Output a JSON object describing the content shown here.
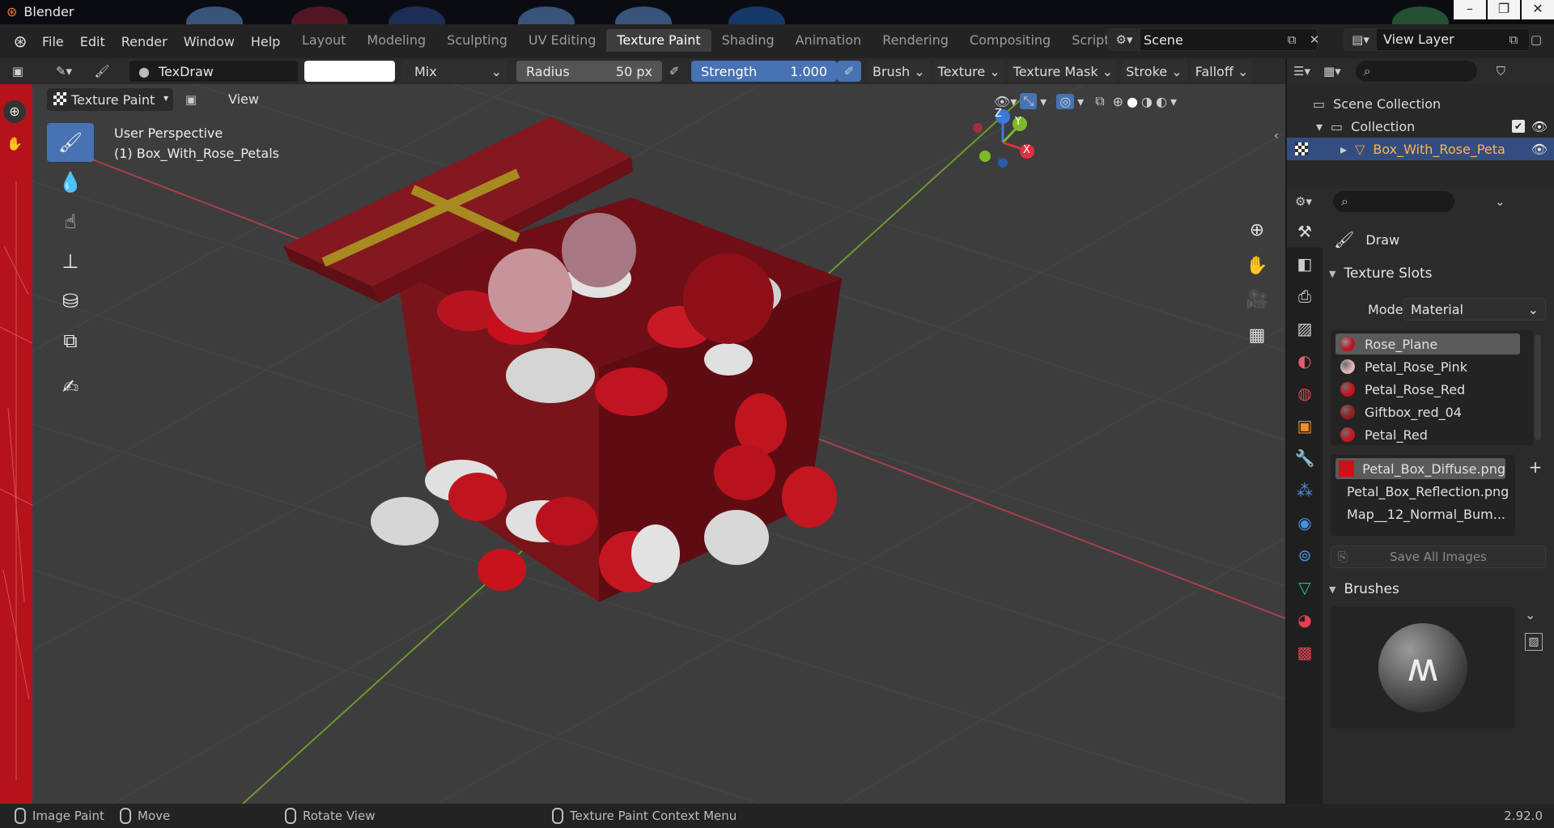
{
  "window": {
    "app_title": "Blender"
  },
  "menu": [
    "File",
    "Edit",
    "Render",
    "Window",
    "Help"
  ],
  "workspaces": [
    "Layout",
    "Modeling",
    "Sculpting",
    "UV Editing",
    "Texture Paint",
    "Shading",
    "Animation",
    "Rendering",
    "Compositing",
    "Scripting"
  ],
  "active_workspace": "Texture Paint",
  "scene": {
    "name": "Scene"
  },
  "view_layer": {
    "name": "View Layer"
  },
  "tool_header": {
    "brush_name": "TexDraw",
    "blend_mode": "Mix",
    "radius_label": "Radius",
    "radius_value": "50 px",
    "strength_label": "Strength",
    "strength_value": "1.000",
    "menus": [
      "Brush",
      "Texture",
      "Texture Mask",
      "Stroke",
      "Falloff"
    ]
  },
  "viewport_header": {
    "mode": "Texture Paint",
    "view": "View"
  },
  "viewport": {
    "perspective": "User Perspective",
    "object": "(1) Box_With_Rose_Petals",
    "gizmo_axes": {
      "z": "Z",
      "y": "Y",
      "x": "X"
    }
  },
  "outliner": {
    "scene_collection": "Scene Collection",
    "collection": "Collection",
    "object": "Box_With_Rose_Peta"
  },
  "properties": {
    "tool_name": "Draw",
    "texture_slots_title": "Texture Slots",
    "mode_label": "Mode",
    "mode_value": "Material",
    "materials": [
      {
        "name": "Rose_Plane",
        "color": "#c01420"
      },
      {
        "name": "Petal_Rose_Pink",
        "color": "#e0b0b8"
      },
      {
        "name": "Petal_Rose_Red",
        "color": "#c8101c"
      },
      {
        "name": "Giftbox_red_04",
        "color": "#9a1a20"
      },
      {
        "name": "Petal_Red",
        "color": "#c8141c"
      }
    ],
    "images": [
      {
        "name": "Petal_Box_Diffuse.png",
        "color": "#d01018"
      },
      {
        "name": "Petal_Box_Reflection.png",
        "color": "#000000"
      },
      {
        "name": "Map__12_Normal_Bum...",
        "color": "#8a80ff"
      }
    ],
    "save_all_images": "Save All Images",
    "brushes_title": "Brushes"
  },
  "status_bar": {
    "image_paint": "Image Paint",
    "move": "Move",
    "rotate_view": "Rotate View",
    "context_menu": "Texture Paint Context Menu",
    "version": "2.92.0"
  }
}
